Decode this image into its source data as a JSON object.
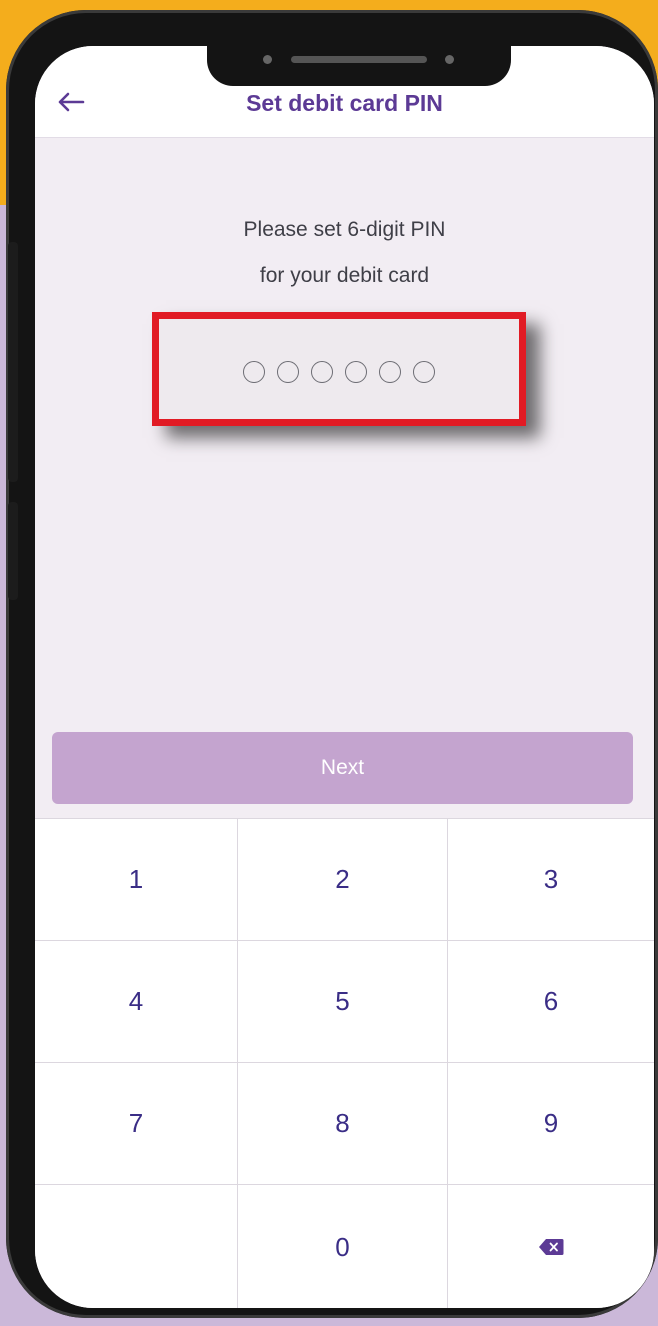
{
  "header": {
    "back_icon": "arrow-left-icon",
    "title": "Set debit card PIN"
  },
  "instruction": {
    "line1": "Please set 6-digit PIN",
    "line2": "for your debit card"
  },
  "pin": {
    "length": 6,
    "filled": 0
  },
  "next_button": {
    "label": "Next",
    "enabled": false
  },
  "keypad": {
    "keys": [
      "1",
      "2",
      "3",
      "4",
      "5",
      "6",
      "7",
      "8",
      "9",
      "",
      "0",
      "backspace"
    ],
    "backspace_icon": "backspace-icon"
  },
  "colors": {
    "accent": "#5c3a95",
    "key_text": "#3a2d86",
    "next_disabled": "#c4a4cf",
    "highlight": "#e11b24",
    "screen_bg": "#f2edf3",
    "backdrop_top": "#f4ad1c",
    "backdrop_bottom": "#cbb8d9"
  }
}
